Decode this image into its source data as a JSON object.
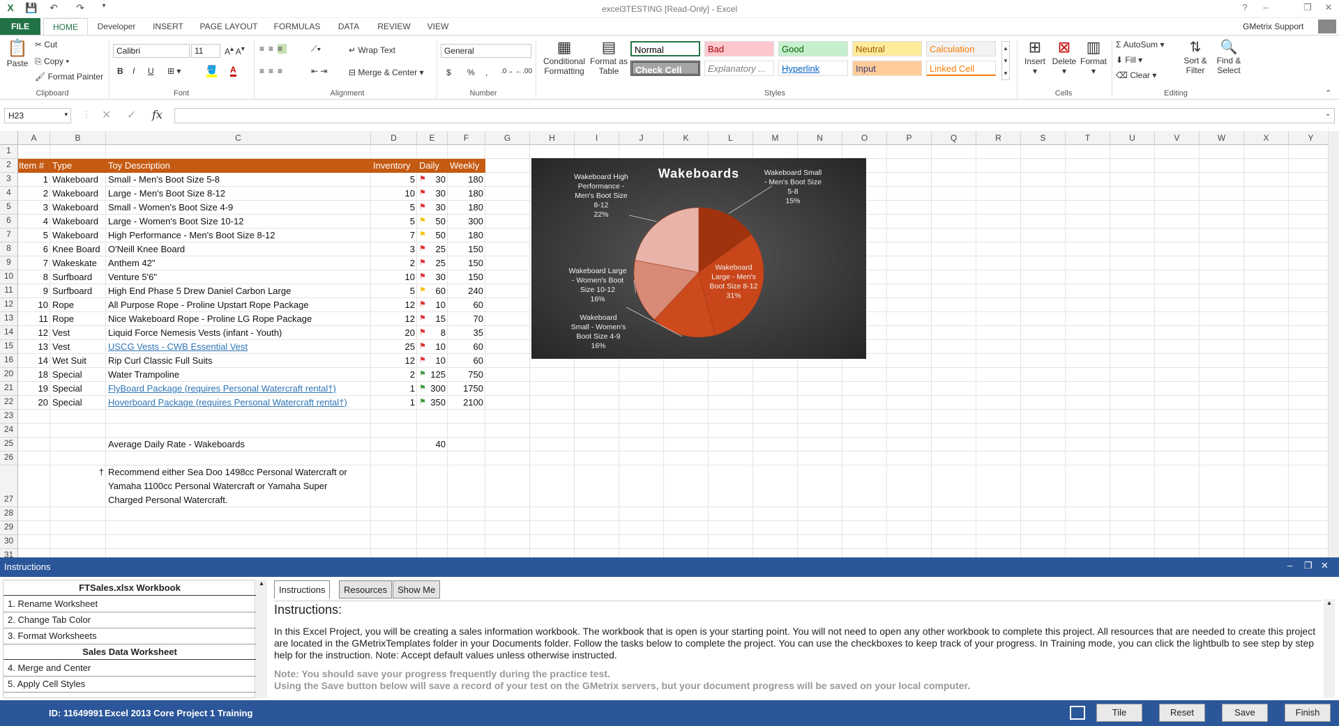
{
  "window": {
    "title": "excel3TESTING  [Read-Only] - Excel",
    "user": "GMetrix Support",
    "controls": [
      "?",
      "–",
      "❐",
      "✕"
    ]
  },
  "ribbon_tabs": [
    "FILE",
    "HOME",
    "Developer",
    "INSERT",
    "PAGE LAYOUT",
    "FORMULAS",
    "DATA",
    "REVIEW",
    "VIEW"
  ],
  "clipboard": {
    "paste": "Paste",
    "cut": "Cut",
    "copy": "Copy",
    "format_painter": "Format Painter",
    "label": "Clipboard"
  },
  "font": {
    "name": "Calibri",
    "size": "11",
    "bold": "B",
    "italic": "I",
    "underline": "U",
    "label": "Font"
  },
  "alignment": {
    "wrap_text": "Wrap Text",
    "merge_center": "Merge & Center",
    "label": "Alignment"
  },
  "number": {
    "format": "General",
    "currency": "$",
    "percent": "%",
    "comma": ",",
    "label": "Number"
  },
  "styles": {
    "conditional_formatting": "Conditional Formatting",
    "format_as_table": "Format as Table",
    "cells": [
      {
        "name": "Normal",
        "bg": "#ffffff",
        "fg": "#000000"
      },
      {
        "name": "Bad",
        "bg": "#ffc7ce",
        "fg": "#9c0006"
      },
      {
        "name": "Good",
        "bg": "#c6efce",
        "fg": "#006100"
      },
      {
        "name": "Neutral",
        "bg": "#ffeb9c",
        "fg": "#9c5700"
      },
      {
        "name": "Calculation",
        "bg": "#f2f2f2",
        "fg": "#fa7d00"
      },
      {
        "name": "Check Cell",
        "bg": "#a5a5a5",
        "fg": "#ffffff"
      },
      {
        "name": "Explanatory ...",
        "bg": "#ffffff",
        "fg": "#7f7f7f"
      },
      {
        "name": "Hyperlink",
        "bg": "#ffffff",
        "fg": "#0563c1"
      },
      {
        "name": "Input",
        "bg": "#ffcc99",
        "fg": "#3f3f76"
      },
      {
        "name": "Linked Cell",
        "bg": "#ffffff",
        "fg": "#fa7d00"
      }
    ],
    "label": "Styles"
  },
  "cells_group": {
    "insert": "Insert",
    "delete": "Delete",
    "format": "Format",
    "label": "Cells"
  },
  "editing": {
    "autosum": "AutoSum",
    "fill": "Fill",
    "clear": "Clear",
    "sort_filter": "Sort & Filter",
    "find_select": "Find & Select",
    "label": "Editing"
  },
  "formula_bar": {
    "name_box": "H23",
    "formula": ""
  },
  "columns": [
    "A",
    "B",
    "C",
    "D",
    "E",
    "F",
    "G",
    "H",
    "I",
    "J",
    "K",
    "L",
    "M",
    "N",
    "O",
    "P",
    "Q",
    "R",
    "S",
    "T",
    "U",
    "V",
    "W",
    "X",
    "Y"
  ],
  "rows": [
    "1",
    "2",
    "3",
    "4",
    "5",
    "6",
    "7",
    "8",
    "9",
    "10",
    "11",
    "12",
    "13",
    "14",
    "15",
    "16",
    "20",
    "21",
    "22",
    "23",
    "24",
    "25",
    "26",
    "27",
    "28",
    "29",
    "30",
    "31"
  ],
  "table_header": [
    "Item #",
    "Type",
    "Toy Description",
    "Inventory",
    "Daily",
    "Weekly"
  ],
  "table_rows": [
    {
      "item": "1",
      "type": "Wakeboard",
      "desc": "Small - Men's Boot Size 5-8",
      "inv": "5",
      "flag": "red",
      "daily": "30",
      "weekly": "180"
    },
    {
      "item": "2",
      "type": "Wakeboard",
      "desc": "Large - Men's Boot Size 8-12",
      "inv": "10",
      "flag": "red",
      "daily": "30",
      "weekly": "180"
    },
    {
      "item": "3",
      "type": "Wakeboard",
      "desc": "Small - Women's Boot Size 4-9",
      "inv": "5",
      "flag": "red",
      "daily": "30",
      "weekly": "180"
    },
    {
      "item": "4",
      "type": "Wakeboard",
      "desc": "Large - Women's Boot Size 10-12",
      "inv": "5",
      "flag": "yellow",
      "daily": "50",
      "weekly": "300"
    },
    {
      "item": "5",
      "type": "Wakeboard",
      "desc": "High Performance - Men's Boot Size 8-12",
      "inv": "7",
      "flag": "yellow",
      "daily": "50",
      "weekly": "180"
    },
    {
      "item": "6",
      "type": "Knee Board",
      "desc": "O'Neill Knee Board",
      "inv": "3",
      "flag": "red",
      "daily": "25",
      "weekly": "150"
    },
    {
      "item": "7",
      "type": "Wakeskate",
      "desc": "Anthem 42\"",
      "inv": "2",
      "flag": "red",
      "daily": "25",
      "weekly": "150"
    },
    {
      "item": "8",
      "type": "Surfboard",
      "desc": "Venture 5'6\"",
      "inv": "10",
      "flag": "red",
      "daily": "30",
      "weekly": "150"
    },
    {
      "item": "9",
      "type": "Surfboard",
      "desc": "High End Phase 5 Drew Daniel Carbon Large",
      "inv": "5",
      "flag": "yellow",
      "daily": "60",
      "weekly": "240"
    },
    {
      "item": "10",
      "type": "Rope",
      "desc": "All Purpose Rope - Proline Upstart Rope Package",
      "inv": "12",
      "flag": "red",
      "daily": "10",
      "weekly": "60"
    },
    {
      "item": "11",
      "type": "Rope",
      "desc": "Nice Wakeboard Rope - Proline LG Rope Package",
      "inv": "12",
      "flag": "red",
      "daily": "15",
      "weekly": "70"
    },
    {
      "item": "12",
      "type": "Vest",
      "desc": "Liquid Force Nemesis Vests (infant - Youth)",
      "inv": "20",
      "flag": "red",
      "daily": "8",
      "weekly": "35"
    },
    {
      "item": "13",
      "type": "Vest",
      "desc": "USCG Vests - CWB Essential Vest",
      "inv": "25",
      "flag": "red",
      "daily": "10",
      "weekly": "60",
      "link": true
    },
    {
      "item": "14",
      "type": "Wet Suit",
      "desc": "Rip Curl Classic Full Suits",
      "inv": "12",
      "flag": "red",
      "daily": "10",
      "weekly": "60"
    },
    {
      "item": "18",
      "type": "Special",
      "desc": "Water Trampoline",
      "inv": "2",
      "flag": "green",
      "daily": "125",
      "weekly": "750"
    },
    {
      "item": "19",
      "type": "Special",
      "desc": "FlyBoard Package (requires Personal Watercraft rental†)",
      "inv": "1",
      "flag": "green",
      "daily": "300",
      "weekly": "1750",
      "link": true
    },
    {
      "item": "20",
      "type": "Special",
      "desc": "Hoverboard Package (requires Personal Watercraft rental†)",
      "inv": "1",
      "flag": "green",
      "daily": "350",
      "weekly": "2100",
      "link": true
    }
  ],
  "avg_label": "Average Daily Rate - Wakeboards",
  "avg_value": "40",
  "footnote_mark": "†",
  "footnote_lines": [
    "Recommend either Sea Doo 1498cc Personal Watercraft or",
    "Yamaha 1100cc Personal Watercraft or Yamaha Super",
    "Charged Personal Watercraft."
  ],
  "chart_data": {
    "type": "pie",
    "title": "Wakeboards",
    "slices": [
      {
        "label": "Wakeboard Small - Men's Boot Size 5-8",
        "lines": [
          "Wakeboard Small",
          "- Men's Boot Size",
          "5-8"
        ],
        "pct": "15%",
        "value": 15,
        "color": "#a0330d"
      },
      {
        "label": "Wakeboard Large - Men's Boot Size 8-12",
        "lines": [
          "Wakeboard",
          "Large - Men's",
          "Boot Size 8-12"
        ],
        "pct": "31%",
        "value": 31,
        "color": "#c9461a"
      },
      {
        "label": "Wakeboard Small - Women's Boot Size 4-9",
        "lines": [
          "Wakeboard",
          "Small - Women's",
          "Boot Size 4-9"
        ],
        "pct": "16%",
        "value": 16,
        "color": "#cc4a1c"
      },
      {
        "label": "Wakeboard Large - Women's Boot Size 10-12",
        "lines": [
          "Wakeboard Large",
          "- Women's Boot",
          "Size 10-12"
        ],
        "pct": "16%",
        "value": 16,
        "color": "#d98a76"
      },
      {
        "label": "Wakeboard High Performance - Men's Boot Size 8-12",
        "lines": [
          "Wakeboard High",
          "Performance -",
          "Men's Boot Size",
          "8-12"
        ],
        "pct": "22%",
        "value": 22,
        "color": "#e8b3a8"
      }
    ]
  },
  "instructions": {
    "title": "Instructions",
    "workbook_title": "FTSales.xlsx Workbook",
    "steps_a": [
      "1. Rename Worksheet",
      "2. Change Tab Color",
      "3. Format Worksheets"
    ],
    "section_b": "Sales Data Worksheet",
    "steps_b": [
      "4. Merge and Center",
      "5. Apply Cell Styles"
    ],
    "tabs": [
      "Instructions",
      "Resources",
      "Show Me"
    ],
    "heading": "Instructions:",
    "body": "In this Excel Project, you will be creating a sales information workbook. The workbook that is open is your starting point. You will not need to open any other workbook to complete this project. All resources that are needed to create this project are located in the GMetrixTemplates folder in your Documents folder. Follow the tasks below to complete the project. You can use the checkboxes to keep track of your progress. In Training mode, you can click the lightbulb to see step by step help for the instruction. Note: Accept default values unless otherwise instructed.",
    "note1": "Note: You should save your progress frequently during the practice test.",
    "note2": "Using the Save button below will save a record of your test on the GMetrix servers, but your document progress will be saved on your local computer."
  },
  "status": {
    "id": "ID: 11649991",
    "project": "Excel 2013 Core Project 1 Training",
    "buttons": [
      "Tile",
      "Reset",
      "Save",
      "Finish"
    ]
  },
  "colors": {
    "excel_green": "#217346",
    "header_orange": "#c55a11",
    "pane_blue": "#2b579a"
  }
}
